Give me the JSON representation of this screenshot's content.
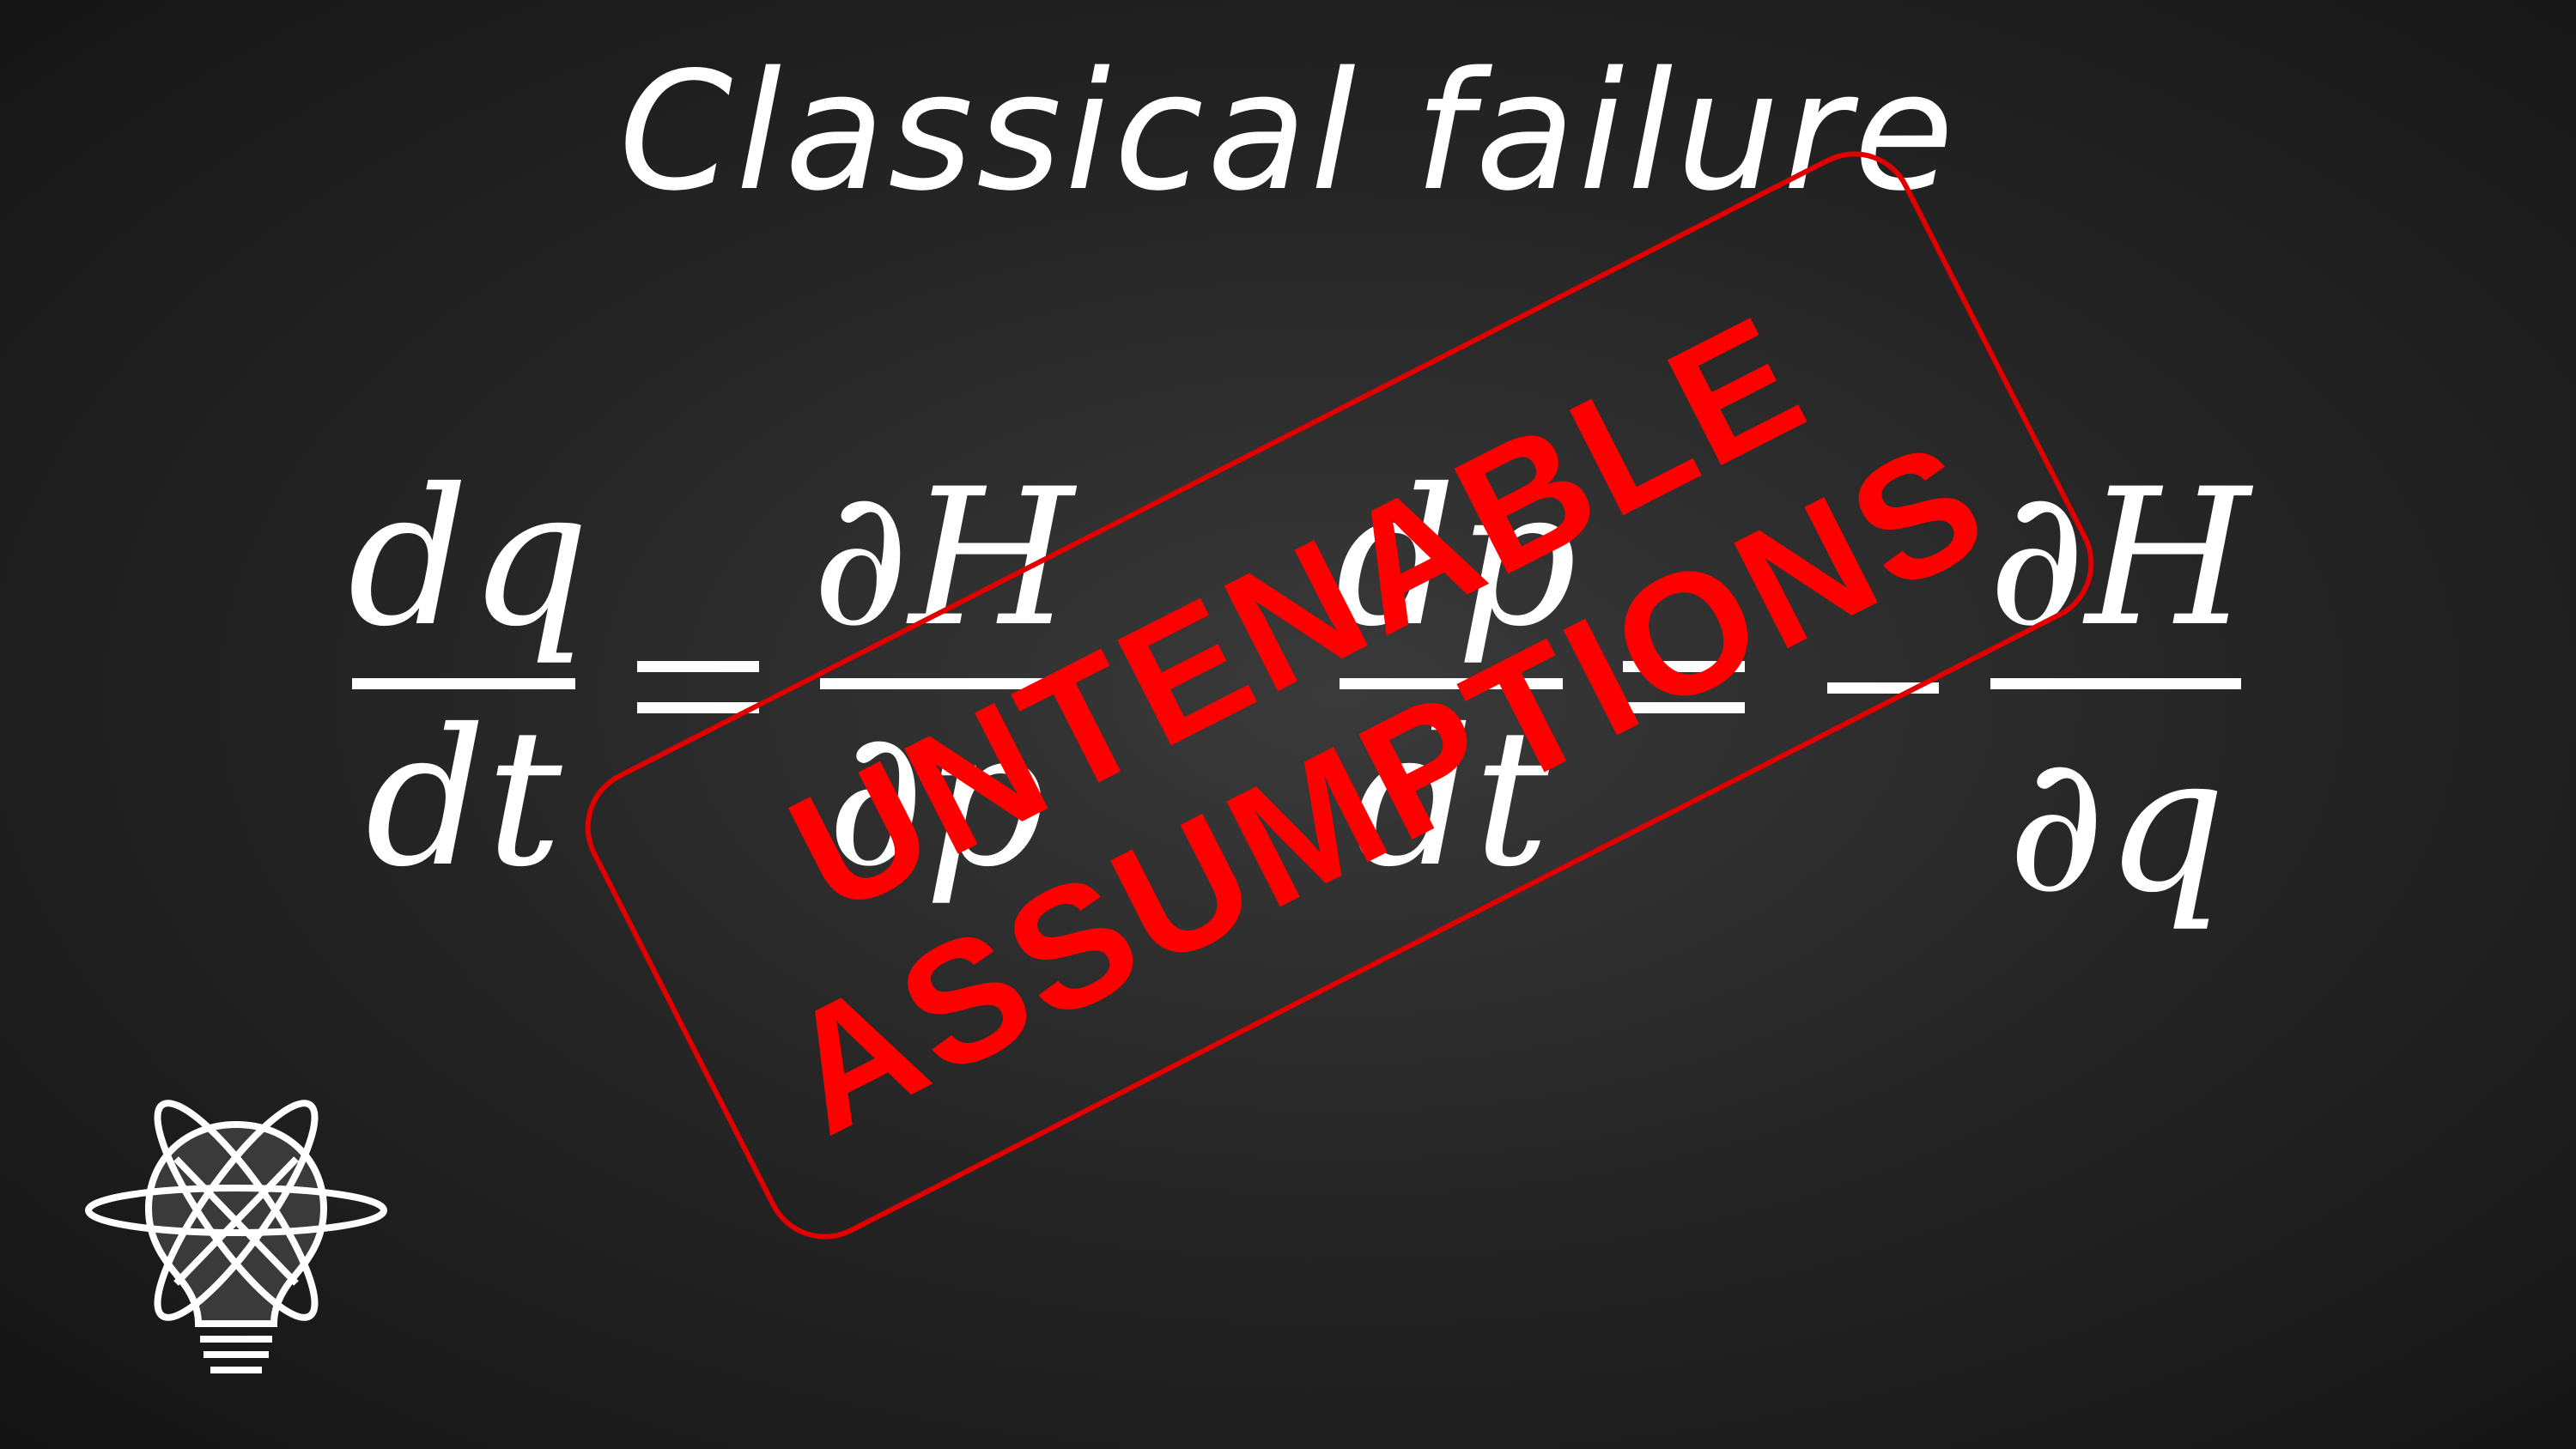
{
  "slide": {
    "title": "Classical failure",
    "equation": {
      "left": {
        "numerator": "dq",
        "denominator": "dt",
        "equals": "=",
        "rhs_numerator": "∂H",
        "rhs_denominator": "∂p"
      },
      "right": {
        "numerator": "dp",
        "denominator": "dt",
        "equals": "=",
        "minus": "−",
        "rhs_numerator": "∂H",
        "rhs_denominator": "∂q"
      }
    },
    "stamp": {
      "line1": "UNTENABLE",
      "line2": "ASSUMPTIONS",
      "color": "#ff0000"
    },
    "logo": {
      "icon": "lightbulb-atom-icon",
      "color": "#ffffff"
    }
  }
}
